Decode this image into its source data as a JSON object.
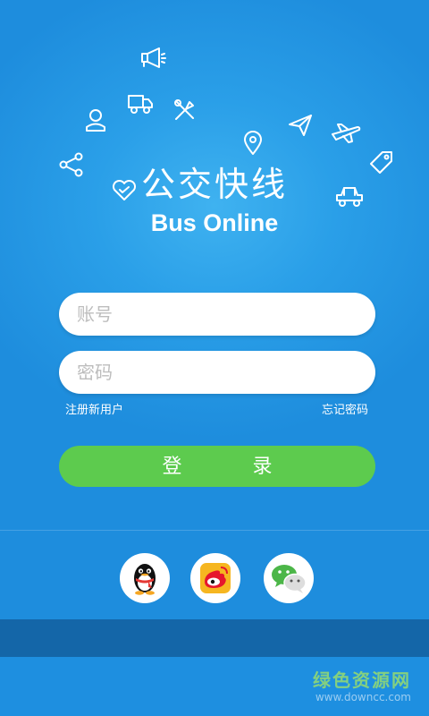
{
  "app": {
    "title_cn": "公交快线",
    "title_en": "Bus Online"
  },
  "decor_icons": [
    "megaphone-icon",
    "truck-icon",
    "tools-icon",
    "user-icon",
    "location-pin-icon",
    "paper-plane-icon",
    "airplane-icon",
    "tag-icon",
    "share-icon",
    "heart-icon",
    "car-icon"
  ],
  "login": {
    "account_placeholder": "账号",
    "password_placeholder": "密码",
    "register_label": "注册新用户",
    "forgot_label": "忘记密码",
    "login_label": "登 录"
  },
  "social": [
    {
      "name": "qq",
      "icon": "qq-penguin-icon"
    },
    {
      "name": "weibo",
      "icon": "weibo-icon"
    },
    {
      "name": "wechat",
      "icon": "wechat-icon"
    }
  ],
  "watermark": {
    "cn": "绿色资源网",
    "en": "www.downcc.com"
  },
  "colors": {
    "background": "#1E8FE0",
    "login_button": "#5DCB4E",
    "bottom_band": "#1466A8",
    "field_background": "#FFFFFF"
  }
}
